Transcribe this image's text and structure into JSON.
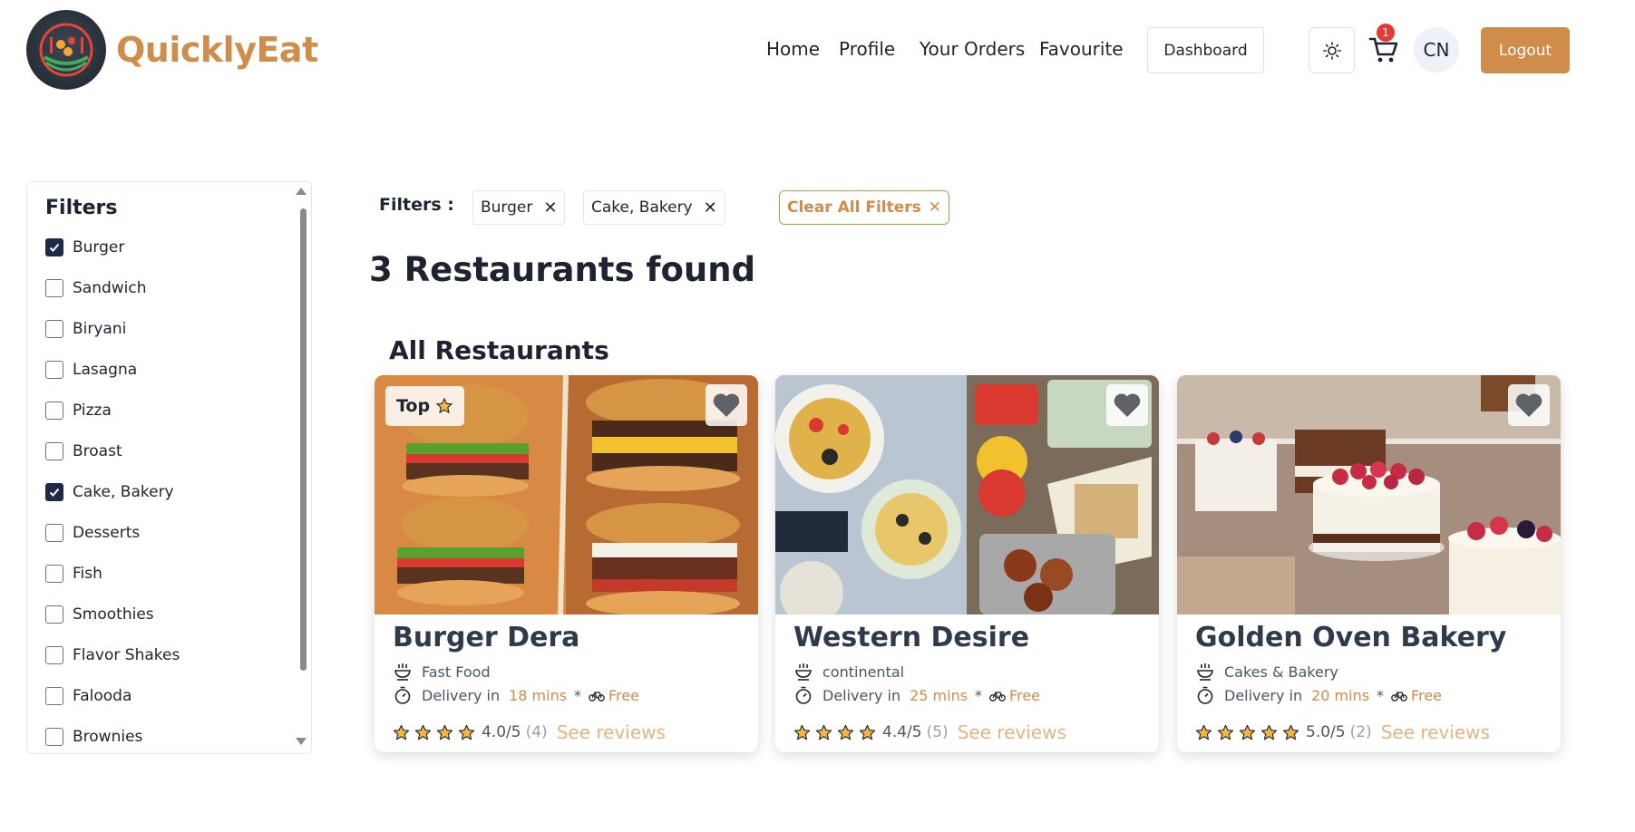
{
  "brand": {
    "name": "QuicklyEat"
  },
  "nav": {
    "home": "Home",
    "profile": "Profile",
    "orders": "Your Orders",
    "favourite": "Favourite",
    "dashboard": "Dashboard",
    "cart_count": "1",
    "avatar_initials": "CN",
    "logout": "Logout"
  },
  "sidebar": {
    "title": "Filters",
    "items": [
      {
        "label": "Burger",
        "checked": true
      },
      {
        "label": "Sandwich",
        "checked": false
      },
      {
        "label": "Biryani",
        "checked": false
      },
      {
        "label": "Lasagna",
        "checked": false
      },
      {
        "label": "Pizza",
        "checked": false
      },
      {
        "label": "Broast",
        "checked": false
      },
      {
        "label": "Cake, Bakery",
        "checked": true
      },
      {
        "label": "Desserts",
        "checked": false
      },
      {
        "label": "Fish",
        "checked": false
      },
      {
        "label": "Smoothies",
        "checked": false
      },
      {
        "label": "Flavor Shakes",
        "checked": false
      },
      {
        "label": "Falooda",
        "checked": false
      },
      {
        "label": "Brownies",
        "checked": false
      }
    ]
  },
  "active_filters": {
    "label": "Filters :",
    "chips": [
      "Burger",
      "Cake, Bakery"
    ],
    "clear_label": "Clear All Filters"
  },
  "results": {
    "found_text": "3 Restaurants found",
    "section_title": "All Restaurants"
  },
  "restaurants": [
    {
      "name": "Burger Dera",
      "category": "Fast Food",
      "delivery_label": "Delivery in",
      "delivery_time": "18 mins",
      "delivery_fee": "Free",
      "rating": "4.0/5",
      "reviews_count": "(4)",
      "stars": 4,
      "see_reviews": "See reviews",
      "badge": "Top"
    },
    {
      "name": "Western Desire",
      "category": "continental",
      "delivery_label": "Delivery in",
      "delivery_time": "25 mins",
      "delivery_fee": "Free",
      "rating": "4.4/5",
      "reviews_count": "(5)",
      "stars": 4,
      "see_reviews": "See reviews"
    },
    {
      "name": "Golden Oven Bakery",
      "category": "Cakes & Bakery",
      "delivery_label": "Delivery in",
      "delivery_time": "20 mins",
      "delivery_fee": "Free",
      "rating": "5.0/5",
      "reviews_count": "(2)",
      "stars": 5,
      "see_reviews": "See reviews"
    }
  ],
  "colors": {
    "accent": "#cf8c4b",
    "star": "#f4b63e",
    "badge": "#e53935"
  }
}
